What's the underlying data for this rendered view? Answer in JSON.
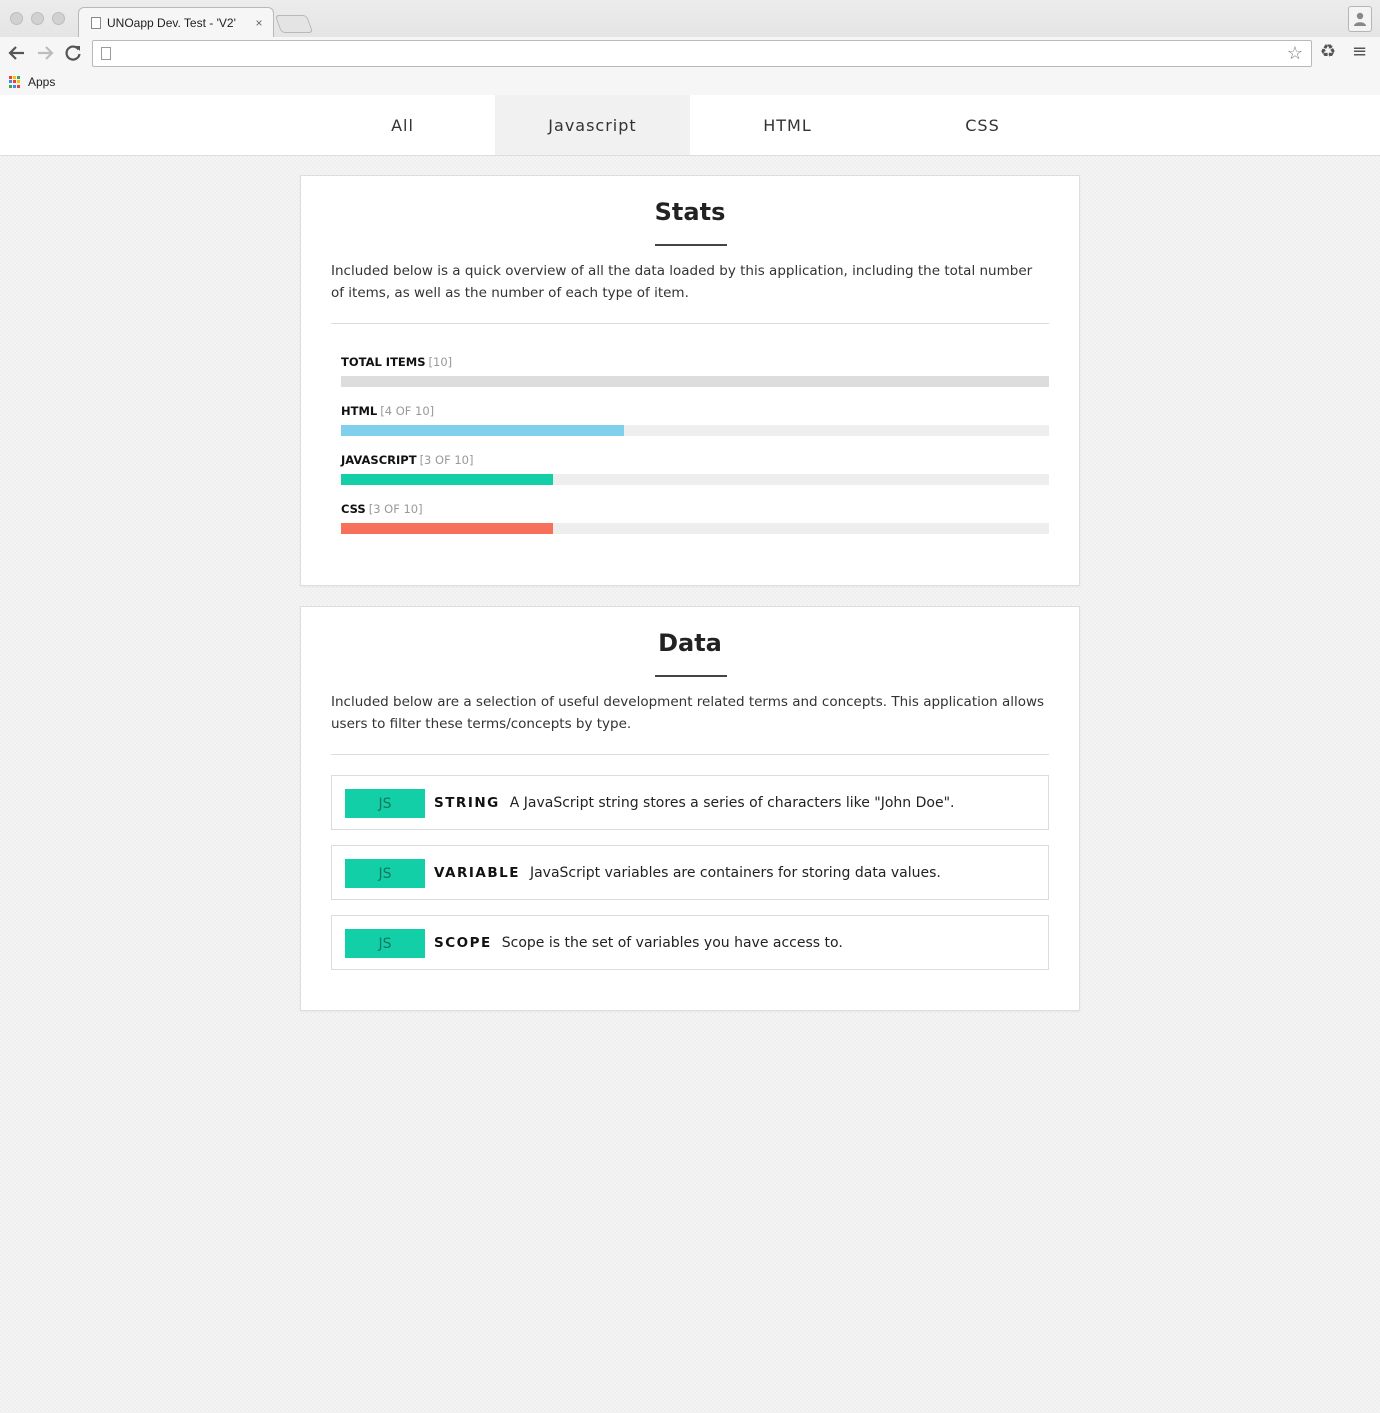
{
  "browser": {
    "tab_title": "UNOapp Dev. Test - 'V2'",
    "tab_close": "×",
    "address_value": "",
    "bookmarks_apps": "Apps",
    "apps_colors": [
      "#e94235",
      "#fbbc04",
      "#34a853",
      "#4285f4",
      "#e94235",
      "#fbbc04",
      "#34a853",
      "#4285f4",
      "#e94235"
    ]
  },
  "nav": {
    "tabs": [
      {
        "label": "All",
        "active": false
      },
      {
        "label": "Javascript",
        "active": true
      },
      {
        "label": "HTML",
        "active": false
      },
      {
        "label": "CSS",
        "active": false
      }
    ]
  },
  "stats": {
    "title": "Stats",
    "description": "Included below is a quick overview of all the data loaded by this application, including the total number of items, as well as the number of each type of item.",
    "rows": [
      {
        "label": "TOTAL ITEMS",
        "count": "[10]",
        "value": 10,
        "total": 10,
        "color": "#dddddd"
      },
      {
        "label": "HTML",
        "count": "[4 OF 10]",
        "value": 4,
        "total": 10,
        "color": "#7fcfed"
      },
      {
        "label": "JAVASCRIPT",
        "count": "[3 OF 10]",
        "value": 3,
        "total": 10,
        "color": "#13cfa7"
      },
      {
        "label": "CSS",
        "count": "[3 OF 10]",
        "value": 3,
        "total": 10,
        "color": "#f6705a"
      }
    ]
  },
  "data_section": {
    "title": "Data",
    "description": "Included below are a selection of useful development related terms and concepts. This application allows users to filter these terms/concepts by type.",
    "items": [
      {
        "badge": "JS",
        "badge_color": "#13cfa7",
        "name": "STRING",
        "text": "A JavaScript string stores a series of characters like \"John Doe\"."
      },
      {
        "badge": "JS",
        "badge_color": "#13cfa7",
        "name": "VARIABLE",
        "text": "JavaScript variables are containers for storing data values."
      },
      {
        "badge": "JS",
        "badge_color": "#13cfa7",
        "name": "SCOPE",
        "text": "Scope is the set of variables you have access to."
      }
    ]
  }
}
